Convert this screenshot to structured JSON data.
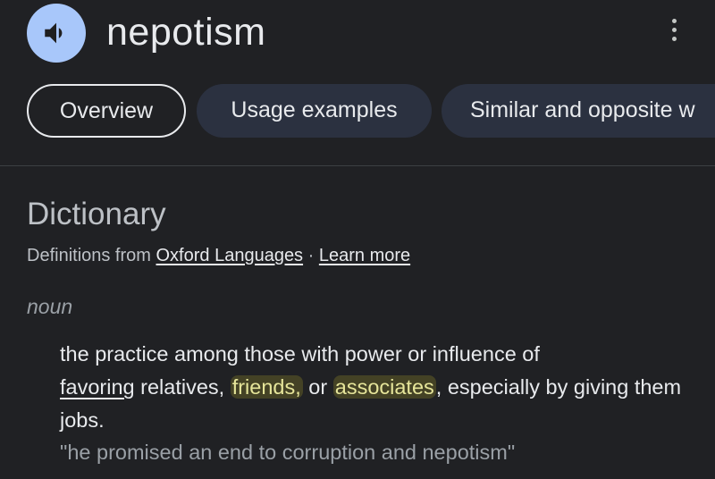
{
  "header": {
    "word": "nepotism",
    "speaker_icon": "speaker-icon",
    "more_icon": "more-vert-icon"
  },
  "tabs": [
    {
      "label": "Overview",
      "selected": true
    },
    {
      "label": "Usage examples",
      "selected": false
    },
    {
      "label": "Similar and opposite w",
      "selected": false
    }
  ],
  "dictionary": {
    "title": "Dictionary",
    "source_prefix": "Definitions from",
    "source_link": "Oxford Languages",
    "separator": "·",
    "learn_more": "Learn more",
    "part_of_speech": "noun",
    "definition": {
      "part1": "the practice among those with power or influence of",
      "favoring": "favoring",
      "part2": " relatives, ",
      "friends": "friends,",
      "part3": " or ",
      "associates": "associates",
      "part4": ", especially by giving them jobs."
    },
    "example": "\"he promised an end to corruption and nepotism\""
  },
  "colors": {
    "background": "#202124",
    "speaker_button": "#a8c7fa",
    "tab_fill": "#2b3140",
    "highlight_text": "#e6e59a"
  }
}
